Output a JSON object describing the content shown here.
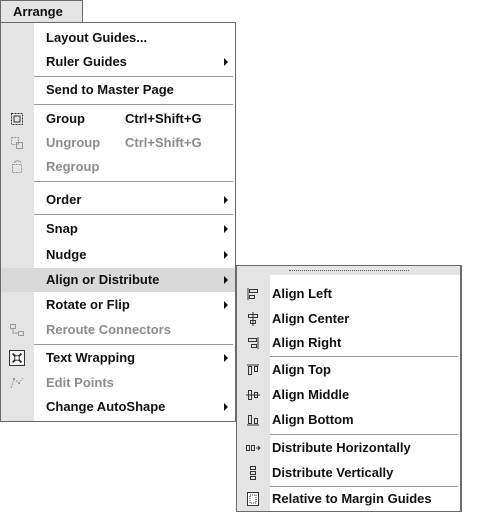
{
  "menubar": {
    "title": "Arrange"
  },
  "main_menu": {
    "layout_guides": "Layout Guides...",
    "ruler_guides": "Ruler Guides",
    "send_to_master": "Send to Master Page",
    "group": {
      "label": "Group",
      "shortcut": "Ctrl+Shift+G"
    },
    "ungroup": {
      "label": "Ungroup",
      "shortcut": "Ctrl+Shift+G"
    },
    "regroup": "Regroup",
    "order": "Order",
    "snap": "Snap",
    "nudge": "Nudge",
    "align_distribute": "Align or Distribute",
    "rotate_flip": "Rotate or Flip",
    "reroute": "Reroute Connectors",
    "text_wrapping": "Text Wrapping",
    "edit_points": "Edit Points",
    "change_autoshape": "Change AutoShape"
  },
  "sub_menu": {
    "align_left": "Align Left",
    "align_center": "Align Center",
    "align_right": "Align Right",
    "align_top": "Align Top",
    "align_middle": "Align Middle",
    "align_bottom": "Align Bottom",
    "distribute_h": "Distribute Horizontally",
    "distribute_v": "Distribute Vertically",
    "relative_margin": "Relative to Margin Guides"
  },
  "icons": {
    "group": "group-icon",
    "ungroup": "ungroup-icon",
    "regroup": "regroup-icon",
    "reroute": "reroute-connectors-icon",
    "text_wrapping": "text-wrapping-icon",
    "edit_points": "edit-points-icon",
    "align_left": "align-left-icon",
    "align_center": "align-center-icon",
    "align_right": "align-right-icon",
    "align_top": "align-top-icon",
    "align_middle": "align-middle-icon",
    "align_bottom": "align-bottom-icon",
    "distribute_h": "distribute-horizontally-icon",
    "distribute_v": "distribute-vertically-icon",
    "relative_margin": "relative-to-margin-icon"
  },
  "colors": {
    "menu_bg": "#ffffff",
    "gutter": "#e4e4e4",
    "highlight": "#d9d9d9",
    "disabled_text": "#8c8c8c"
  }
}
